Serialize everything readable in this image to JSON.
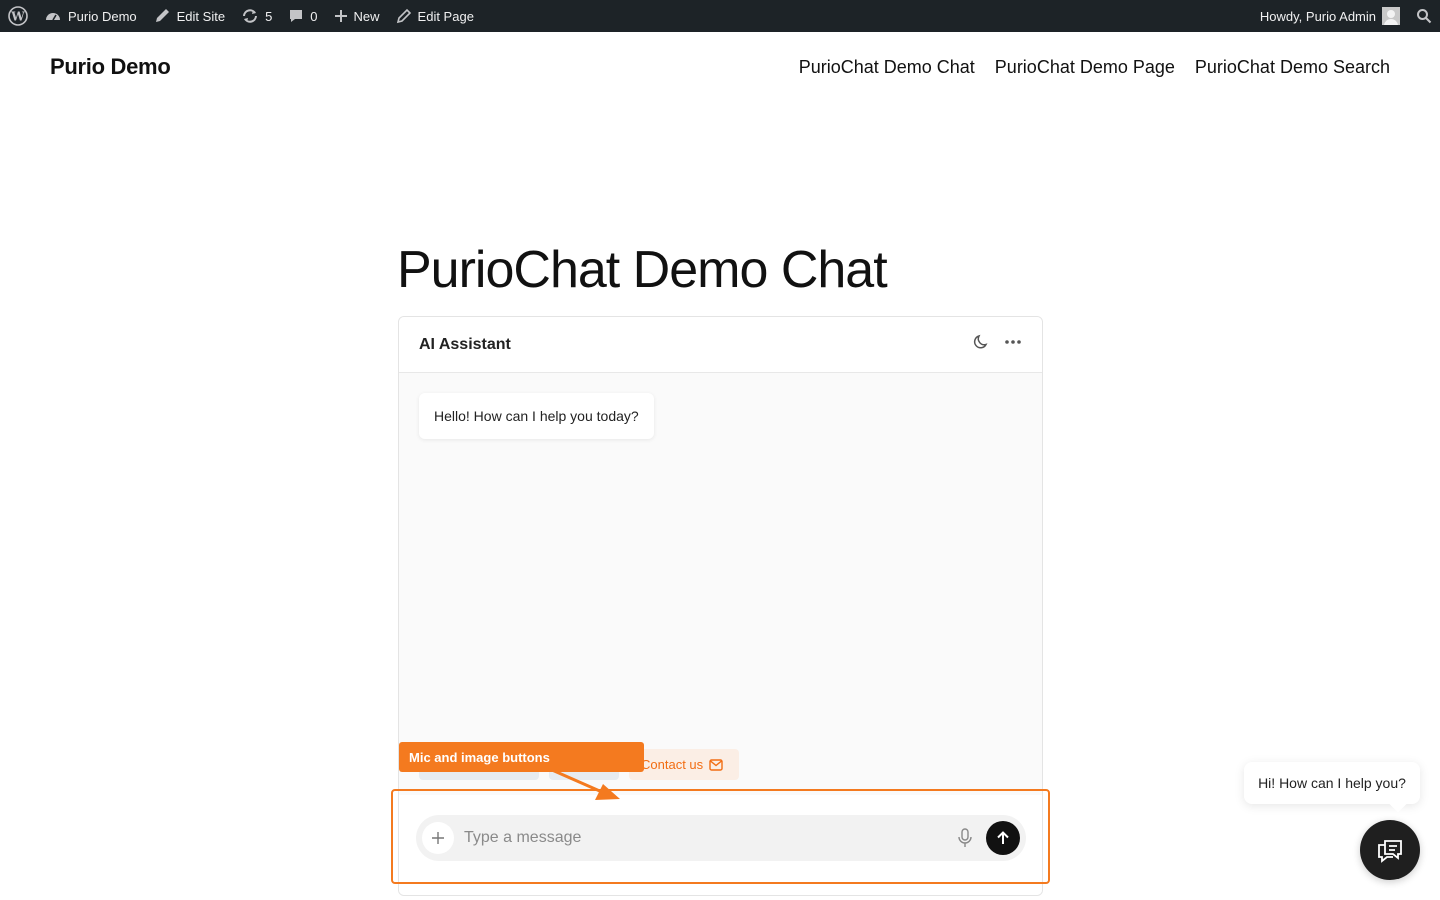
{
  "adminbar": {
    "site_name": "Purio Demo",
    "edit_site": "Edit Site",
    "updates_count": "5",
    "comments_count": "0",
    "new_label": "New",
    "edit_page": "Edit Page",
    "howdy": "Howdy, Purio Admin"
  },
  "site": {
    "title": "Purio Demo",
    "nav": [
      "PurioChat Demo Chat",
      "PurioChat Demo Page",
      "PurioChat Demo Search"
    ]
  },
  "page": {
    "title": "PurioChat Demo Chat"
  },
  "chat": {
    "header_title": "AI Assistant",
    "greeting": "Hello! How can I help you today?",
    "contact_chip": "Contact us",
    "input_placeholder": "Type a message"
  },
  "annotation": {
    "label": "Mic and image buttons",
    "color": "#f47a1f"
  },
  "widget": {
    "bubble_text": "Hi! How can I help you?"
  }
}
